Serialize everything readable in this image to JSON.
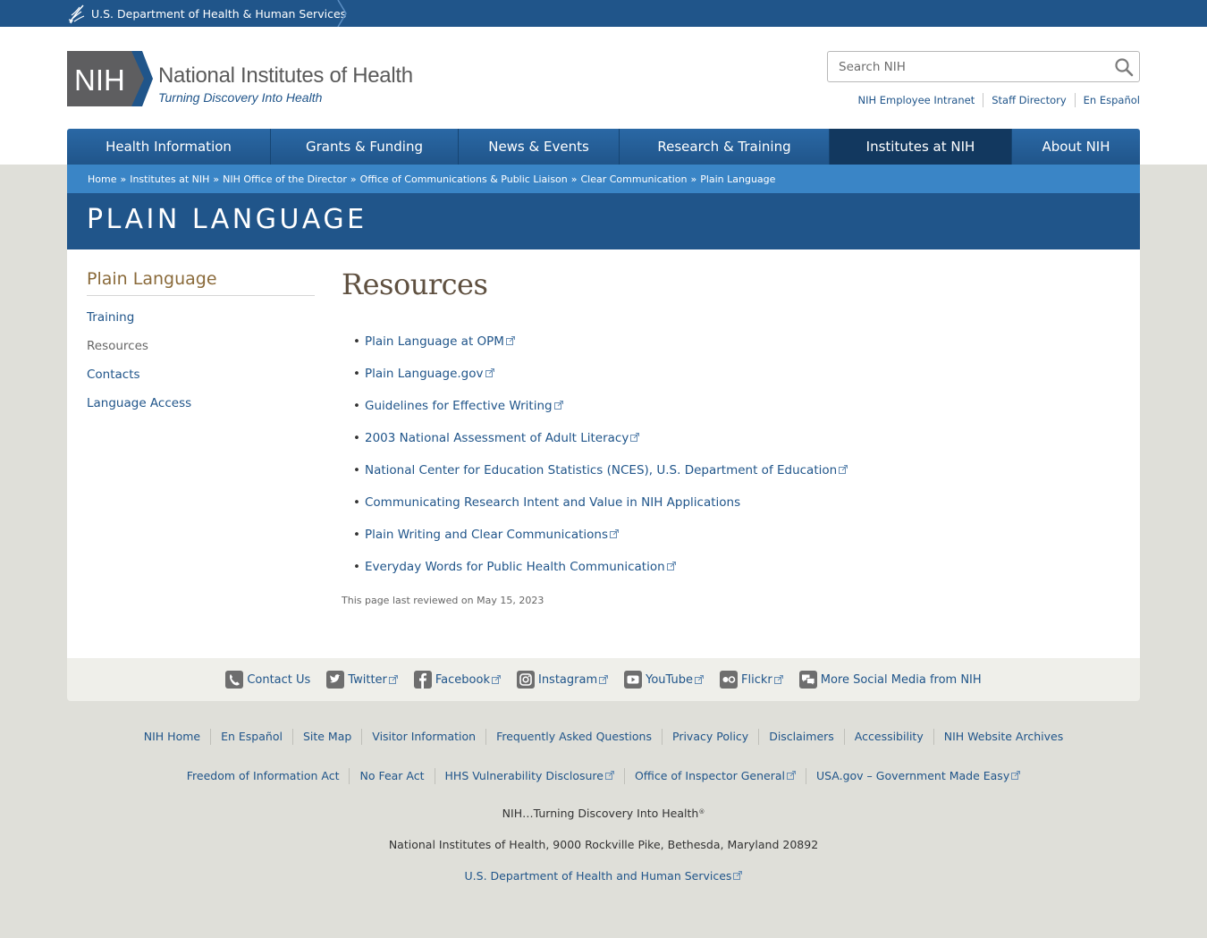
{
  "hhs_bar": {
    "label": "U.S. Department of Health & Human Services"
  },
  "logo": {
    "abbr": "NIH",
    "title": "National Institutes of Health",
    "tagline": "Turning Discovery Into Health"
  },
  "search": {
    "placeholder": "Search NIH"
  },
  "utility_links": [
    "NIH Employee Intranet",
    "Staff Directory",
    "En Español"
  ],
  "nav": [
    {
      "label": "Health Information",
      "active": false
    },
    {
      "label": "Grants & Funding",
      "active": false
    },
    {
      "label": "News & Events",
      "active": false
    },
    {
      "label": "Research & Training",
      "active": false
    },
    {
      "label": "Institutes at NIH",
      "active": true
    },
    {
      "label": "About NIH",
      "active": false
    }
  ],
  "breadcrumb": {
    "items": [
      "Home",
      "Institutes at NIH",
      "NIH Office of the Director",
      "Office of Communications & Public Liaison",
      "Clear Communication",
      "Plain Language"
    ],
    "separator": "»"
  },
  "page_title": "PLAIN LANGUAGE",
  "sidebar": {
    "heading": "Plain Language",
    "items": [
      {
        "label": "Training",
        "current": false
      },
      {
        "label": "Resources",
        "current": true
      },
      {
        "label": "Contacts",
        "current": false
      },
      {
        "label": "Language Access",
        "current": false
      }
    ]
  },
  "main": {
    "heading": "Resources",
    "resources": [
      {
        "label": "Plain Language at OPM",
        "external": true
      },
      {
        "label": "Plain Language.gov",
        "external": true
      },
      {
        "label": "Guidelines for Effective Writing",
        "external": true
      },
      {
        "label": "2003 National Assessment of Adult Literacy",
        "external": true
      },
      {
        "label": "National Center for Education Statistics (NCES), U.S. Department of Education",
        "external": true
      },
      {
        "label": "Communicating Research Intent and Value in NIH Applications",
        "external": false
      },
      {
        "label": "Plain Writing and Clear Communications",
        "external": true
      },
      {
        "label": "Everyday Words for Public Health Communication",
        "external": true
      }
    ],
    "reviewed": "This page last reviewed on May 15, 2023"
  },
  "social": [
    {
      "label": "Contact Us",
      "icon": "phone-icon",
      "external": false
    },
    {
      "label": "Twitter",
      "icon": "twitter-icon",
      "external": true
    },
    {
      "label": "Facebook",
      "icon": "facebook-icon",
      "external": true
    },
    {
      "label": "Instagram",
      "icon": "instagram-icon",
      "external": true
    },
    {
      "label": "YouTube",
      "icon": "youtube-icon",
      "external": true
    },
    {
      "label": "Flickr",
      "icon": "flickr-icon",
      "external": true
    },
    {
      "label": "More Social Media from NIH",
      "icon": "chat-bubbles-icon",
      "external": false
    }
  ],
  "footer": {
    "row1": [
      {
        "label": "NIH Home",
        "external": false
      },
      {
        "label": "En Español",
        "external": false
      },
      {
        "label": "Site Map",
        "external": false
      },
      {
        "label": "Visitor Information",
        "external": false
      },
      {
        "label": "Frequently Asked Questions",
        "external": false
      },
      {
        "label": "Privacy Policy",
        "external": false
      },
      {
        "label": "Disclaimers",
        "external": false
      },
      {
        "label": "Accessibility",
        "external": false
      },
      {
        "label": "NIH Website Archives",
        "external": false
      }
    ],
    "row2": [
      {
        "label": "Freedom of Information Act",
        "external": false
      },
      {
        "label": "No Fear Act",
        "external": false
      },
      {
        "label": "HHS Vulnerability Disclosure",
        "external": true
      },
      {
        "label": "Office of Inspector General",
        "external": true
      },
      {
        "label": "USA.gov – Government Made Easy",
        "external": true
      }
    ],
    "tagline": "NIH…Turning Discovery Into Health",
    "tagline_mark": "®",
    "address": "National Institutes of Health, 9000 Rockville Pike, Bethesda, Maryland 20892",
    "hhs_link": "U.S. Department of Health and Human Services"
  },
  "colors": {
    "primary": "#20558a",
    "nav_active": "#12385f",
    "breadcrumb_bg": "#3a85c6",
    "sidebar_heading": "#8a6a3a",
    "page_bg": "#dfdfd9"
  }
}
